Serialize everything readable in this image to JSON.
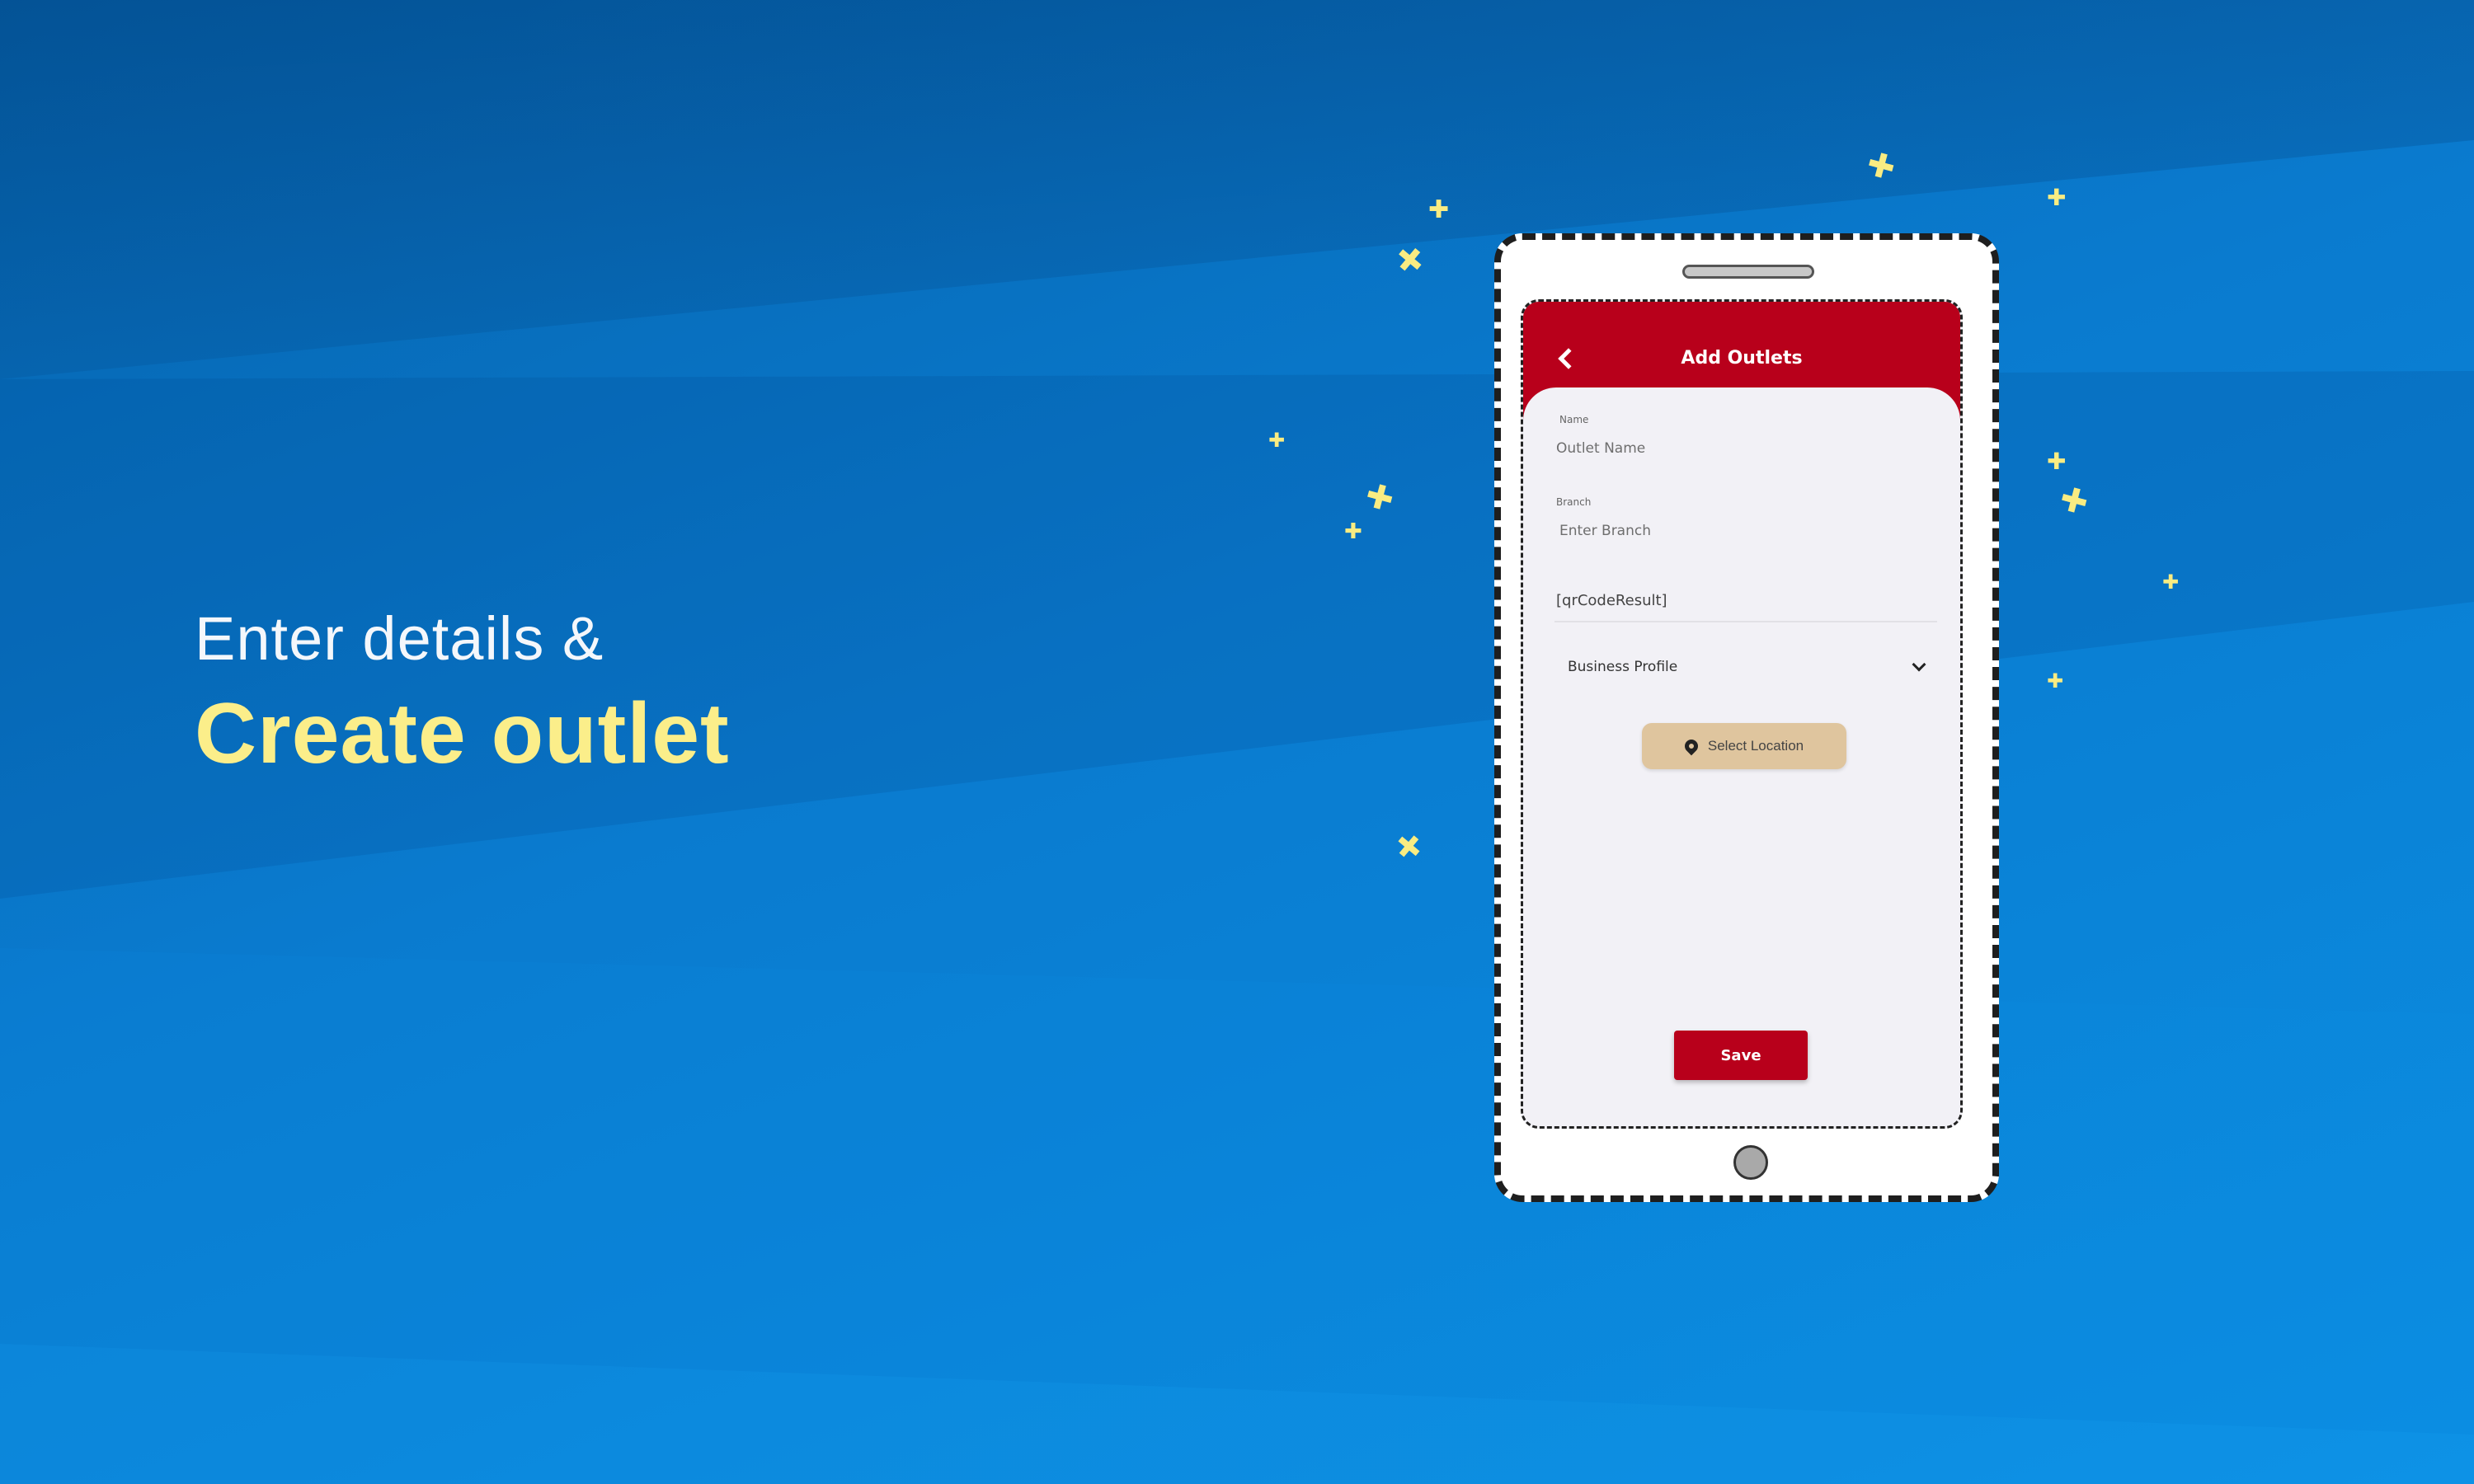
{
  "headline": {
    "line1": "Enter details &",
    "line2": "Create outlet"
  },
  "app": {
    "title": "Add Outlets",
    "back_icon": "chevron-left-icon"
  },
  "form": {
    "name_label": "Name",
    "name_placeholder": "Outlet Name",
    "branch_label": "Branch",
    "branch_placeholder": "Enter Branch",
    "qr_code_text": "[qrCodeResult]",
    "profile_dropdown": "Business Profile",
    "location_button": "Select Location",
    "save_button": "Save"
  },
  "colors": {
    "accent_red": "#b8001b",
    "location_button_bg": "#dfc59e",
    "headline_yellow": "#fbee8a",
    "sparkle": "#f9ec82"
  }
}
